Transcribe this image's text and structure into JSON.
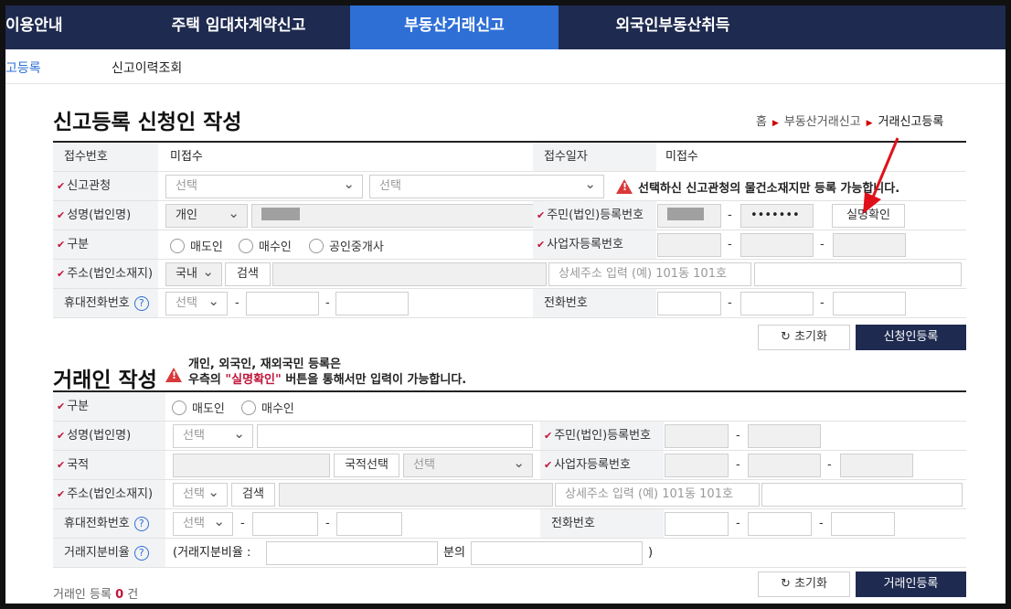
{
  "nav": {
    "tabs": [
      {
        "label": "이용안내"
      },
      {
        "label": "주택 임대차계약신고"
      },
      {
        "label": "부동산거래신고"
      },
      {
        "label": "외국인부동산취득"
      }
    ],
    "subtabs": [
      {
        "label": "고등록"
      },
      {
        "label": "신고이력조회"
      }
    ]
  },
  "applicant": {
    "title": "신고등록 신청인 작성",
    "breadcrumb": [
      "홈",
      "부동산거래신고",
      "거래신고등록"
    ],
    "receipt_no_label": "접수번호",
    "receipt_no_value": "미접수",
    "receipt_date_label": "접수일자",
    "receipt_date_value": "미접수",
    "office_label": "신고관청",
    "select_placeholder": "선택",
    "office_warning": "선택하신 신고관청의 물건소재지만 등록 가능합니다.",
    "name_label": "성명(법인명)",
    "name_type": "개인",
    "resident_no_label": "주민(법인)등록번호",
    "resident_no_masked": "•••••••",
    "verify_button": "실명확인",
    "category_label": "구분",
    "radios": [
      "매도인",
      "매수인",
      "공인중개사"
    ],
    "biz_no_label": "사업자등록번호",
    "address_label": "주소(법인소재지)",
    "address_country": "국내",
    "search_button": "검색",
    "address_detail_placeholder": "상세주소 입력 (예) 101동 101호",
    "mobile_label": "휴대전화번호",
    "phone_label": "전화번호",
    "reset_button": "초기화",
    "register_button": "신청인등록",
    "dash": "-",
    "help": "?"
  },
  "trader": {
    "title": "거래인 작성",
    "notice_line1": "개인, 외국인, 재외국민 등록은",
    "notice_pre": "우측의 ",
    "notice_highlight": "\"실명확인\"",
    "notice_post": " 버튼을 통해서만 입력이 가능합니다.",
    "category_label": "구분",
    "radios": [
      "매도인",
      "매수인"
    ],
    "name_label": "성명(법인명)",
    "resident_no_label": "주민(법인)등록번호",
    "nationality_label": "국적",
    "nationality_button": "국적선택",
    "biz_no_label": "사업자등록번호",
    "address_label": "주소(법인소재지)",
    "search_button": "검색",
    "address_detail_placeholder": "상세주소 입력 (예) 101동 101호",
    "mobile_label": "휴대전화번호",
    "phone_label": "전화번호",
    "ratio_label": "거래지분비율",
    "ratio_open": "(거래지분비율 :",
    "ratio_of": "분의",
    "ratio_close": ")",
    "count_prefix": "거래인 등록",
    "count_value": "0",
    "count_suffix": "건",
    "reset_button": "초기화",
    "register_button": "거래인등록",
    "select_placeholder": "선택"
  },
  "colors": {
    "navy": "#1e2a4f",
    "active_tab": "#2e6fd6",
    "warning_red": "#d9383a",
    "arrow_red": "#e0101a"
  }
}
